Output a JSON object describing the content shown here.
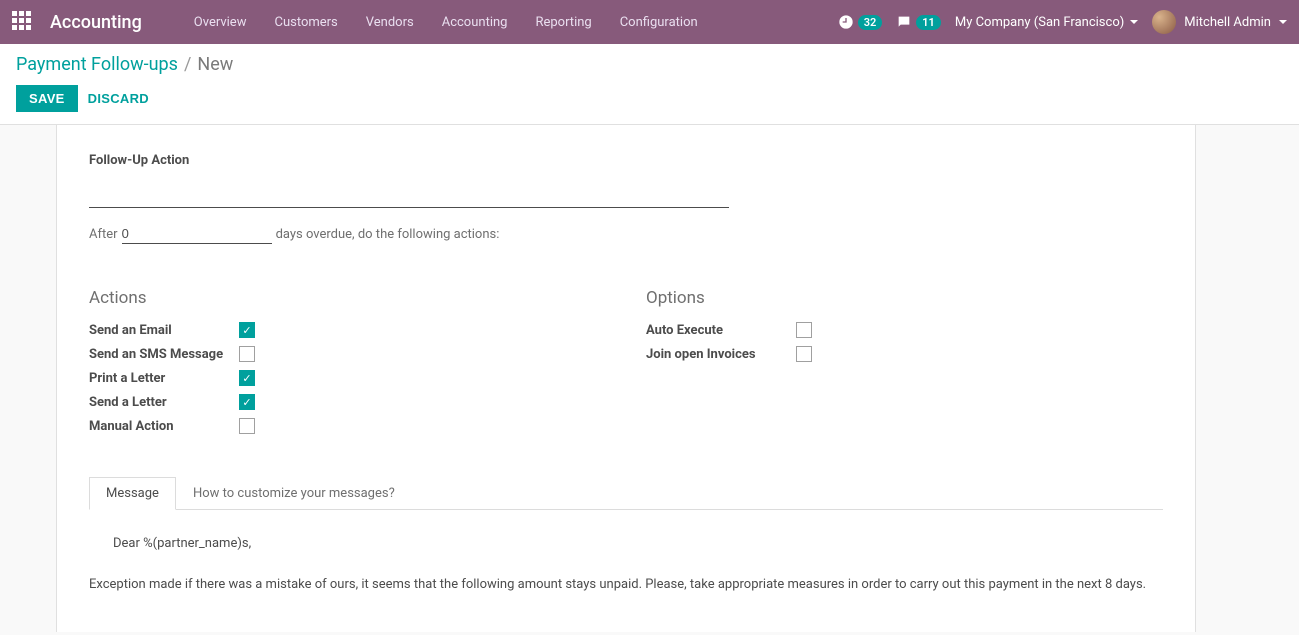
{
  "topnav": {
    "brand": "Accounting",
    "menu": [
      "Overview",
      "Customers",
      "Vendors",
      "Accounting",
      "Reporting",
      "Configuration"
    ],
    "activity_badge": "32",
    "discuss_badge": "11",
    "company": "My Company (San Francisco)",
    "user": "Mitchell Admin"
  },
  "breadcrumb": {
    "parent": "Payment Follow-ups",
    "current": "New"
  },
  "buttons": {
    "save": "SAVE",
    "discard": "DISCARD"
  },
  "form": {
    "title_label": "Follow-Up Action",
    "title_value": "",
    "after_prefix": "After",
    "days_value": "0",
    "after_suffix": "days overdue, do the following actions:",
    "actions_header": "Actions",
    "options_header": "Options",
    "actions": [
      {
        "label": "Send an Email",
        "checked": true
      },
      {
        "label": "Send an SMS Message",
        "checked": false
      },
      {
        "label": "Print a Letter",
        "checked": true
      },
      {
        "label": "Send a Letter",
        "checked": true
      },
      {
        "label": "Manual Action",
        "checked": false
      }
    ],
    "options": [
      {
        "label": "Auto Execute",
        "checked": false
      },
      {
        "label": "Join open Invoices",
        "checked": false
      }
    ],
    "tabs": [
      "Message",
      "How to customize your messages?"
    ],
    "message": {
      "salutation": "Dear %(partner_name)s,",
      "body": "Exception made if there was a mistake of ours, it seems that the following amount stays unpaid. Please, take appropriate measures in order to carry out this payment in the next 8 days."
    }
  }
}
